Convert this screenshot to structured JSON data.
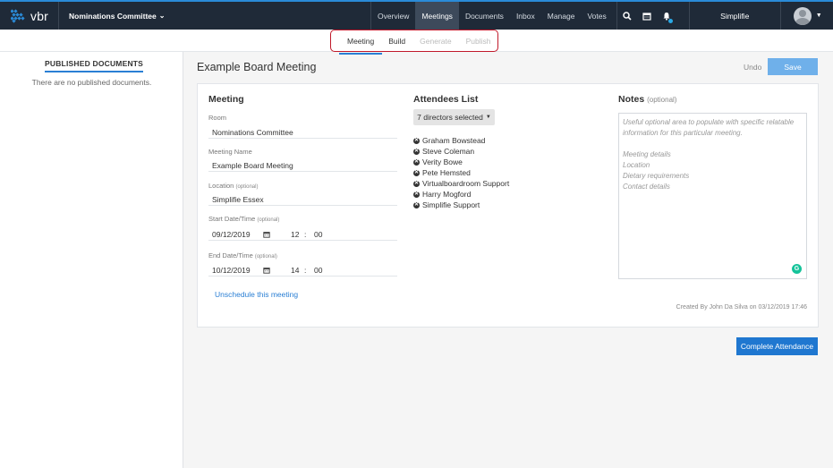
{
  "brand": {
    "name": "vbr",
    "accent": "#2a8bd8"
  },
  "committee": {
    "label": "Nominations Committee"
  },
  "nav": {
    "items": [
      {
        "label": "Overview"
      },
      {
        "label": "Meetings"
      },
      {
        "label": "Documents"
      },
      {
        "label": "Inbox"
      },
      {
        "label": "Manage"
      },
      {
        "label": "Votes"
      }
    ],
    "active": "Meetings",
    "icons": [
      "search-icon",
      "calendar-icon",
      "bell-icon"
    ]
  },
  "user": {
    "org": "Simplifie"
  },
  "subtabs": {
    "items": [
      {
        "label": "Meeting",
        "state": "active"
      },
      {
        "label": "Build",
        "state": "enabled"
      },
      {
        "label": "Generate",
        "state": "disabled"
      },
      {
        "label": "Publish",
        "state": "disabled"
      }
    ]
  },
  "sidebar": {
    "title": "PUBLISHED DOCUMENTS",
    "empty": "There are no published documents."
  },
  "page": {
    "title": "Example Board Meeting",
    "undo": "Undo",
    "save": "Save"
  },
  "meeting": {
    "heading": "Meeting",
    "room_label": "Room",
    "room_value": "Nominations Committee",
    "name_label": "Meeting Name",
    "name_value": "Example Board Meeting",
    "location_label": "Location",
    "location_optional": "(optional)",
    "location_value": "Simplifie Essex",
    "start_label": "Start Date/Time",
    "start_optional": "(optional)",
    "start_date": "09/12/2019",
    "start_hour": "12",
    "start_min": "00",
    "end_label": "End Date/Time",
    "end_optional": "(optional)",
    "end_date": "10/12/2019",
    "end_hour": "14",
    "end_min": "00",
    "time_sep": ":",
    "unschedule": "Unschedule this meeting"
  },
  "attendees": {
    "heading": "Attendees List",
    "selector": "7 directors selected",
    "list": [
      "Graham Bowstead",
      "Steve Coleman",
      "Verity Bowe",
      "Pete Hemsted",
      "Virtualboardroom Support",
      "Harry Mogford",
      "Simplifie Support"
    ]
  },
  "notes": {
    "heading": "Notes",
    "optional": "(optional)",
    "placeholder_1": "Useful optional area to populate with specific relatable information for this particular meeting.",
    "placeholder_2": "Meeting details",
    "placeholder_3": "Location",
    "placeholder_4": "Dietary requirements",
    "placeholder_5": "Contact details",
    "grammarly": "G"
  },
  "created": "Created By John Da Silva on 03/12/2019 17:46",
  "complete_attendance": "Complete Attendance"
}
